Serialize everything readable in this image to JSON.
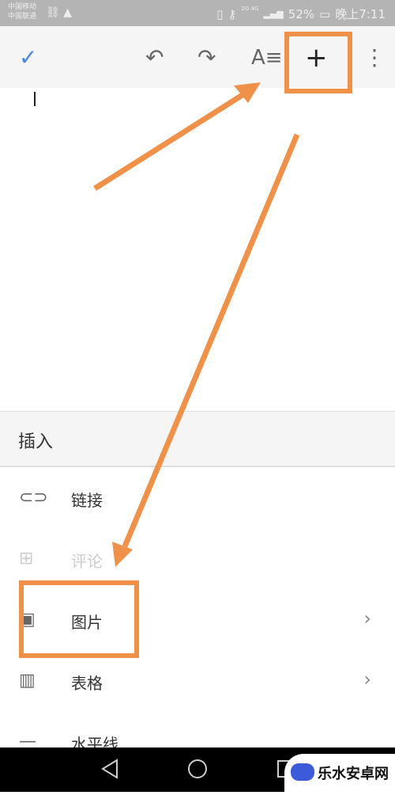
{
  "status_bar": {
    "carrier1": "中国移动",
    "carrier2": "中国联通",
    "signal": "2G 4G",
    "battery": "52%",
    "time": "晚上7:11"
  },
  "toolbar": {
    "done_icon": "check-icon",
    "undo_icon": "undo-icon",
    "redo_icon": "redo-icon",
    "format_icon": "text-format-icon",
    "insert_icon": "plus-icon",
    "more_icon": "more-vert-icon"
  },
  "panel": {
    "title": "插入",
    "items": [
      {
        "label": "链接",
        "icon": "link-icon",
        "enabled": true,
        "submenu": false
      },
      {
        "label": "评论",
        "icon": "comment-add-icon",
        "enabled": false,
        "submenu": false
      },
      {
        "label": "图片",
        "icon": "image-icon",
        "enabled": true,
        "submenu": true
      },
      {
        "label": "表格",
        "icon": "table-icon",
        "enabled": true,
        "submenu": true
      },
      {
        "label": "水平线",
        "icon": "horizontal-line-icon",
        "enabled": true,
        "submenu": false
      }
    ]
  },
  "watermark": {
    "text": "乐水安卓网"
  },
  "colors": {
    "annotation": "#f0914a",
    "accent": "#4a86e0"
  }
}
